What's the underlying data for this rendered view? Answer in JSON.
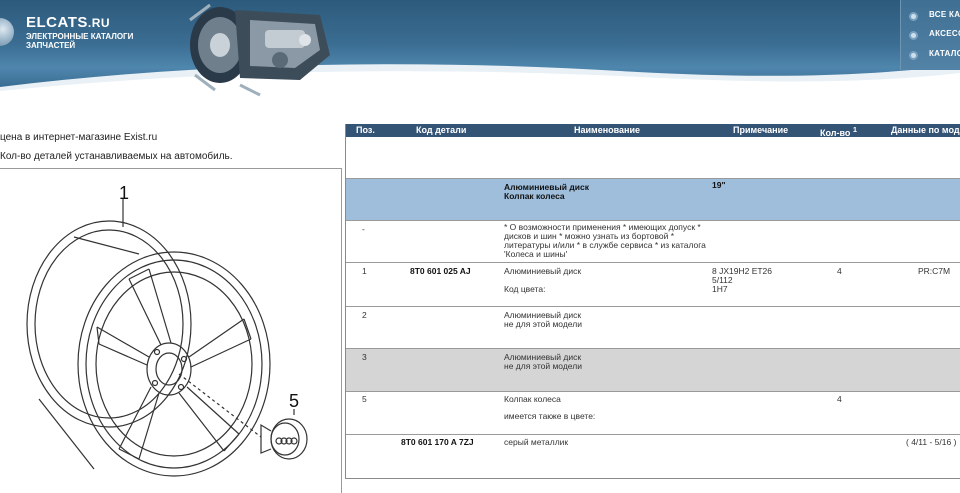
{
  "header": {
    "logo_title": "ELCATS",
    "logo_domain": ".RU",
    "logo_subtitle": "ЭЛЕКТРОННЫЕ КАТАЛОГИ ЗАПЧАСТЕЙ",
    "menu": [
      {
        "label": "ВСЕ КАТ"
      },
      {
        "label": "АКСЕСС"
      },
      {
        "label": "КАТАЛО"
      }
    ]
  },
  "notes": {
    "line1": "цена в интернет-магазине Exist.ru",
    "line2": "Кол-во деталей устанавливаемых на автомобиль."
  },
  "drawing": {
    "callout_1": "1",
    "callout_5": "5"
  },
  "table": {
    "headers": {
      "pos": "Поз.",
      "code": "Код детали",
      "name": "Наименование",
      "note": "Примечание",
      "qty": "Кол-во",
      "qty_sup": "1",
      "data": "Данные по мод"
    },
    "group": {
      "name_line1": "Алюминиевый диск",
      "name_line2": "Колпак колеса",
      "note": "19\""
    },
    "info_row": {
      "pos": "-",
      "text": "* О возможности применения * имеющих допуск * дисков и шин * можно узнать из бортовой * литературы и/или * в службе сервиса * из каталога 'Колеса и шины'"
    },
    "rows": [
      {
        "pos": "1",
        "code": "8T0 601 025 AJ",
        "name": "Алюминиевый диск",
        "name_extra": "Код цвета:",
        "note_line1": "8 JX19H2 ET26",
        "note_line2": "5/112",
        "note_line3": "1H7",
        "qty": "4",
        "data": "PR:C7M"
      },
      {
        "pos": "2",
        "name": "Алюминиевый диск",
        "name_extra": "не для этой модели"
      },
      {
        "pos": "3",
        "name": "Алюминиевый диск",
        "name_extra": "не для этой модели"
      },
      {
        "pos": "5",
        "name": "Колпак колеса",
        "name_extra": "имеется также в цвете:",
        "qty": "4"
      },
      {
        "code": "8T0 601 170 A 7ZJ",
        "name": "серый металлик",
        "data": "( 4/11 - 5/16 )"
      }
    ]
  }
}
